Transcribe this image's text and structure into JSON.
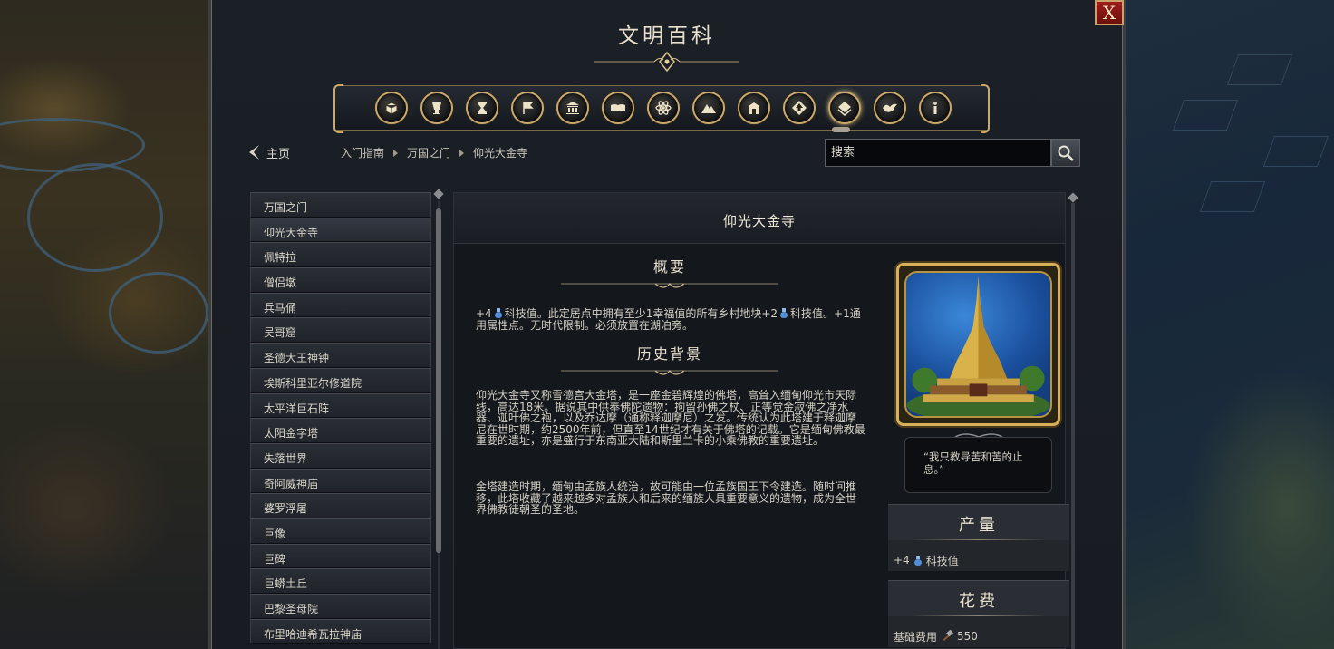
{
  "window": {
    "title": "文明百科",
    "close_label": "X"
  },
  "categories": [
    {
      "icon": "cube-icon",
      "label": ""
    },
    {
      "icon": "goblet-icon",
      "label": ""
    },
    {
      "icon": "hourglass-icon",
      "label": ""
    },
    {
      "icon": "flag-icon",
      "label": ""
    },
    {
      "icon": "temple-icon",
      "label": ""
    },
    {
      "icon": "book-icon",
      "label": ""
    },
    {
      "icon": "atom-icon",
      "label": ""
    },
    {
      "icon": "mountains-icon",
      "label": ""
    },
    {
      "icon": "building-icon",
      "label": ""
    },
    {
      "icon": "up-arrow-icon",
      "label": ""
    },
    {
      "icon": "layers-icon",
      "label": ""
    },
    {
      "icon": "dove-icon",
      "label": ""
    },
    {
      "icon": "info-icon",
      "label": ""
    }
  ],
  "nav": {
    "back_label": "主页",
    "breadcrumb": [
      "入门指南",
      "万国之门",
      "仰光大金寺"
    ],
    "search_placeholder": "搜索"
  },
  "list": {
    "items": [
      "万国之门",
      "仰光大金寺",
      "佩特拉",
      "僧侣墩",
      "兵马俑",
      "吴哥窟",
      "圣德大王神钟",
      "埃斯科里亚尔修道院",
      "太平洋巨石阵",
      "太阳金字塔",
      "失落世界",
      "奇阿威神庙",
      "婆罗浮屠",
      "巨像",
      "巨碑",
      "巨蟒土丘",
      "巴黎圣母院",
      "布里哈迪希瓦拉神庙"
    ],
    "selected_index": 1
  },
  "content": {
    "title": "仰光大金寺",
    "overview": {
      "heading": "概要",
      "part1": "+4",
      "part2": "科技值。此定居点中拥有至少1幸福值的所有乡村地块+2",
      "part3": "科技值。+1通用属性点。无时代限制。必须放置在湖泊旁。"
    },
    "history": {
      "heading": "历史背景",
      "paragraph1": "仰光大金寺又称雪德宫大金塔，是一座金碧辉煌的佛塔，高耸入缅甸仰光市天际线，高达18米。据说其中供奉佛陀遗物：拘留孙佛之杖、正等觉金寂佛之净水器、迦叶佛之袍，以及乔达摩（通称释迦摩尼）之发。传统认为此塔建于释迦摩尼在世时期，约2500年前，但直至14世纪才有关于佛塔的记载。它是缅甸佛教最重要的遗址，亦是盛行于东南亚大陆和斯里兰卡的小乘佛教的重要遗址。",
      "paragraph2": "金塔建造时期，缅甸由孟族人统治，故可能由一位孟族国王下令建造。随时间推移，此塔收藏了越来越多对孟族人和后来的缅族人具重要意义的遗物，成为全世界佛教徒朝圣的圣地。"
    },
    "quote": "“我只教导苦和苦的止息。”",
    "production": {
      "heading": "产量",
      "value": "+4",
      "unit": "科技值"
    },
    "cost": {
      "heading": "花费",
      "label": "基础费用",
      "value": "550"
    }
  },
  "colors": {
    "gold": "#c9a96e",
    "science": "#4f8fd6",
    "close": "#9c1e1a"
  }
}
